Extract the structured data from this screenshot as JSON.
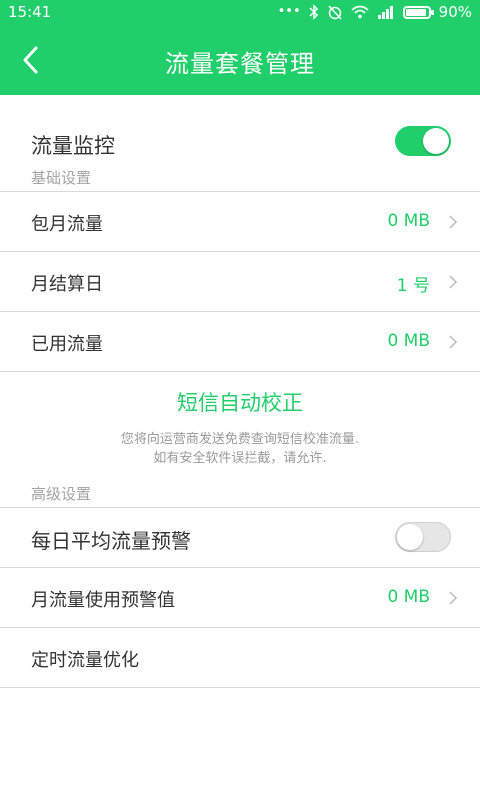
{
  "status_bar": {
    "time": "15:41",
    "icons": [
      "more-dots-icon",
      "bluetooth-icon",
      "alarm-off-icon",
      "wifi-icon",
      "signal-icon"
    ],
    "battery_percent": "90%",
    "battery_level": 0.9
  },
  "header": {
    "title": "流量套餐管理",
    "back_icon": "chevron-left-icon"
  },
  "monitor": {
    "label": "流量监控",
    "enabled": true
  },
  "basic_settings": {
    "section_title": "基础设置",
    "items": [
      {
        "label": "包月流量",
        "value": "0 MB"
      },
      {
        "label": "月结算日",
        "value": "1 号"
      },
      {
        "label": "已用流量",
        "value": "0 MB"
      }
    ]
  },
  "sms_correction": {
    "title": "短信自动校正",
    "desc_line1": "您将向运营商发送免费查询短信校准流量.",
    "desc_line2": "如有安全软件误拦截，请允许."
  },
  "advanced_settings": {
    "section_title": "高级设置",
    "daily_warning": {
      "label": "每日平均流量预警",
      "enabled": false
    },
    "monthly_warning": {
      "label": "月流量使用预警值",
      "value": "0 MB"
    },
    "timed_optimize": {
      "label": "定时流量优化"
    }
  },
  "colors": {
    "accent": "#21cf6a",
    "section_text": "#a4a4a4",
    "divider": "#d9d9d9"
  }
}
